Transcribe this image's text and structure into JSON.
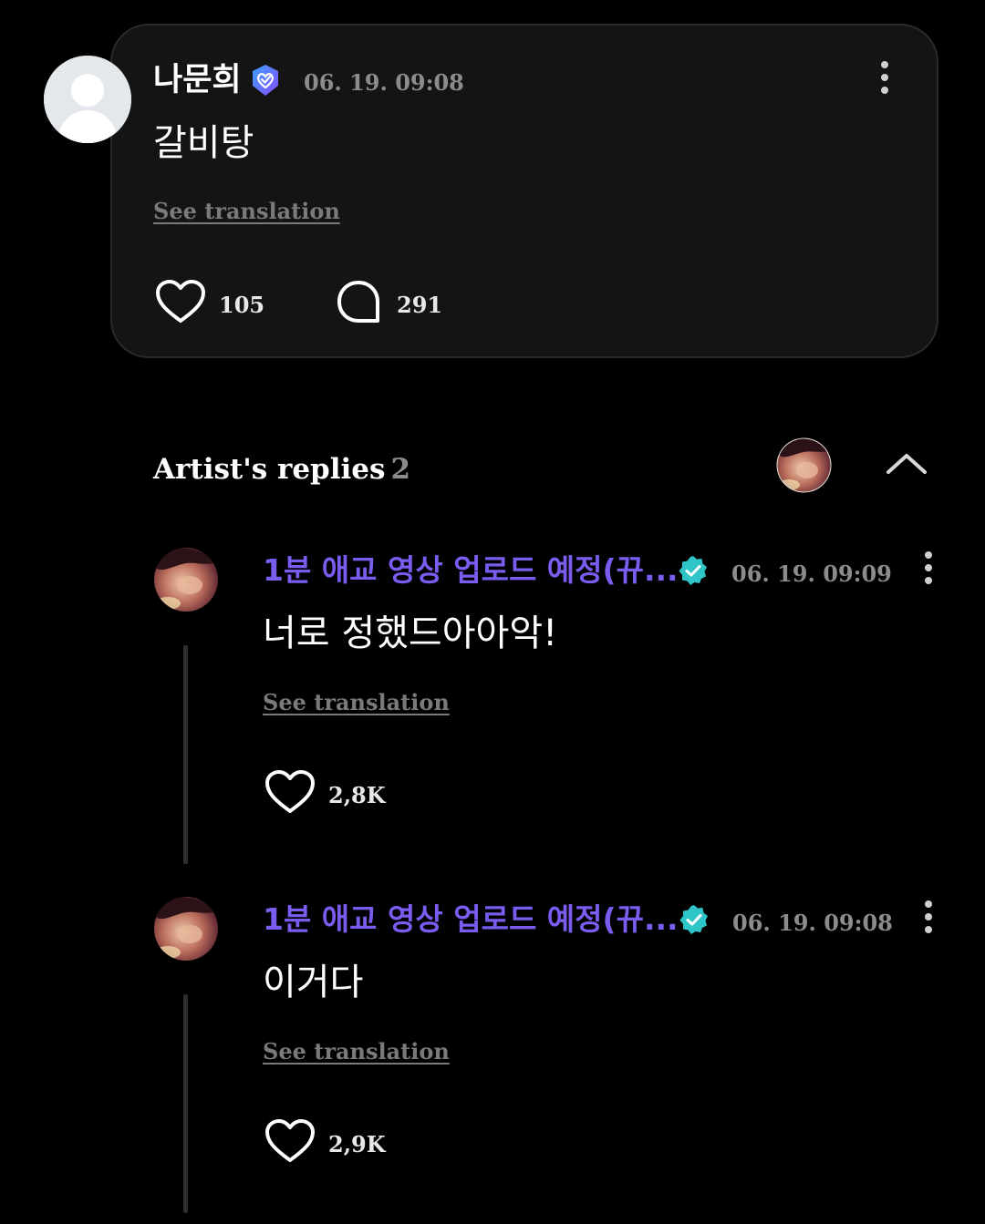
{
  "post": {
    "author": "나문희",
    "timestamp": "06. 19. 09:08",
    "body": "갈비탕",
    "see_translation": "See translation",
    "likes": "105",
    "comments": "291"
  },
  "artist_replies": {
    "title": "Artist's replies",
    "count": "2"
  },
  "replies": [
    {
      "author": "1분 애교 영상 업로드 예정(뀨...",
      "timestamp": "06. 19. 09:09",
      "body": "너로 정했드아아악!",
      "see_translation": "See translation",
      "likes": "2,8K"
    },
    {
      "author": "1분 애교 영상 업로드 예정(뀨...",
      "timestamp": "06. 19. 09:08",
      "body": "이거다",
      "see_translation": "See translation",
      "likes": "2,9K"
    }
  ],
  "colors": {
    "background": "#000000",
    "card": "#141414",
    "artist_name": "#7a5cf0",
    "verified_teal": "#2ec4c8",
    "user_badge": "#6a5cff"
  }
}
